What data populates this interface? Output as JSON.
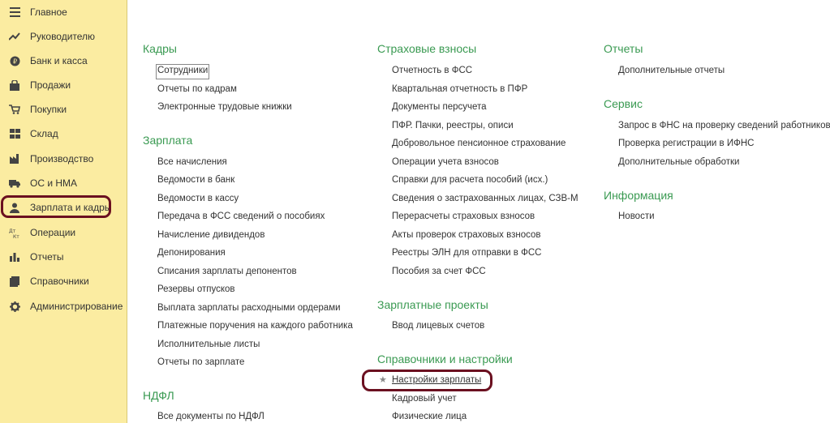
{
  "sidebar": {
    "items": [
      {
        "label": "Главное",
        "icon": "menu-icon"
      },
      {
        "label": "Руководителю",
        "icon": "trend-icon"
      },
      {
        "label": "Банк и касса",
        "icon": "coin-icon"
      },
      {
        "label": "Продажи",
        "icon": "bag-icon"
      },
      {
        "label": "Покупки",
        "icon": "cart-icon"
      },
      {
        "label": "Склад",
        "icon": "warehouse-icon"
      },
      {
        "label": "Производство",
        "icon": "factory-icon"
      },
      {
        "label": "ОС и НМА",
        "icon": "truck-icon"
      },
      {
        "label": "Зарплата и кадры",
        "icon": "person-icon"
      },
      {
        "label": "Операции",
        "icon": "dt-kt-icon"
      },
      {
        "label": "Отчеты",
        "icon": "bar-chart-icon"
      },
      {
        "label": "Справочники",
        "icon": "book-icon"
      },
      {
        "label": "Администрирование",
        "icon": "gear-icon"
      }
    ]
  },
  "columns": {
    "col1": {
      "kadry": {
        "title": "Кадры",
        "links": [
          "Сотрудники",
          "Отчеты по кадрам",
          "Электронные трудовые книжки"
        ]
      },
      "zarplata": {
        "title": "Зарплата",
        "links": [
          "Все начисления",
          "Ведомости в банк",
          "Ведомости в кассу",
          "Передача в ФСС сведений о пособиях",
          "Начисление дивидендов",
          "Депонирования",
          "Списания зарплаты депонентов",
          "Резервы отпусков",
          "Выплата зарплаты расходными ордерами",
          "Платежные поручения на каждого работника",
          "Исполнительные листы",
          "Отчеты по зарплате"
        ]
      },
      "ndfl": {
        "title": "НДФЛ",
        "links": [
          "Все документы по НДФЛ"
        ]
      }
    },
    "col2": {
      "vznosy": {
        "title": "Страховые взносы",
        "links": [
          "Отчетность в ФСС",
          "Квартальная отчетность в ПФР",
          "Документы персучета",
          "ПФР. Пачки, реестры, описи",
          "Добровольное пенсионное страхование",
          "Операции учета взносов",
          "Справки для расчета пособий (исх.)",
          "Сведения о застрахованных лицах, СЗВ-М",
          "Перерасчеты страховых взносов",
          "Акты проверок страховых взносов",
          "Реестры ЭЛН для отправки в ФСС",
          "Пособия за счет ФСС"
        ]
      },
      "projects": {
        "title": "Зарплатные проекты",
        "links": [
          "Ввод лицевых счетов"
        ]
      },
      "settings": {
        "title": "Справочники и настройки",
        "links": [
          "Настройки зарплаты",
          "Кадровый учет",
          "Физические лица"
        ]
      }
    },
    "col3": {
      "reports": {
        "title": "Отчеты",
        "links": [
          "Дополнительные отчеты"
        ]
      },
      "service": {
        "title": "Сервис",
        "links": [
          "Запрос в ФНС на проверку сведений работников",
          "Проверка регистрации в ИФНС",
          "Дополнительные обработки"
        ]
      },
      "info": {
        "title": "Информация",
        "links": [
          "Новости"
        ]
      }
    }
  },
  "colors": {
    "sidebar_bg": "#fbeca1",
    "section_title": "#3a9a52",
    "highlight": "#6b1020"
  }
}
